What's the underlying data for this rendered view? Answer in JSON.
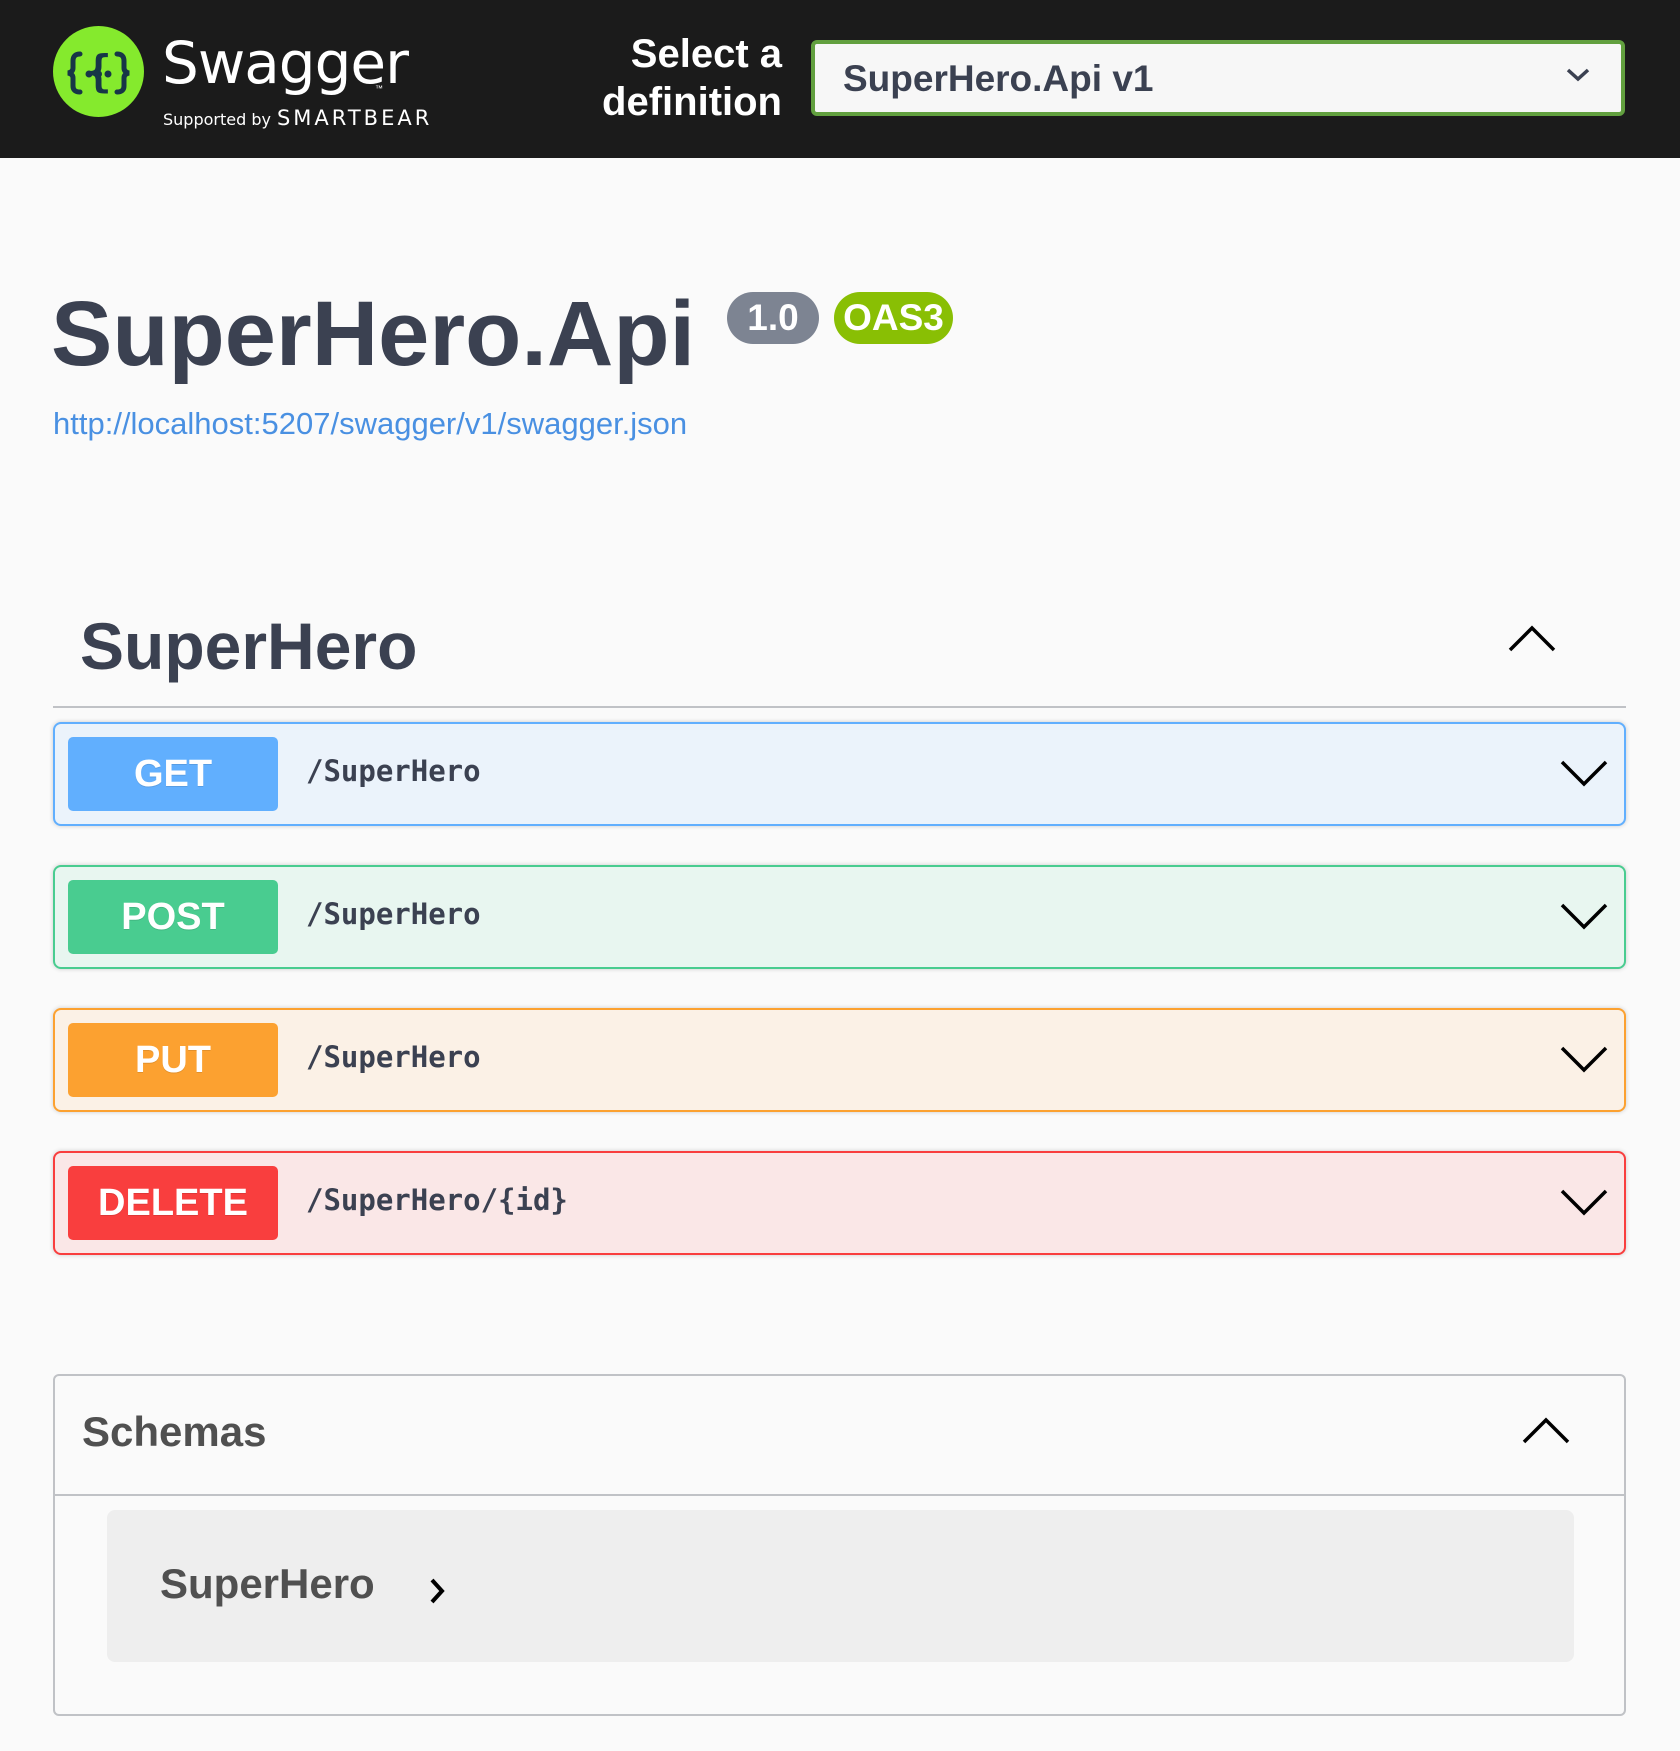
{
  "topbar": {
    "logo_text": "Swagger",
    "logo_tm": "™",
    "logo_sub_small": "Supported by",
    "logo_sub_brand": "SMARTBEAR",
    "select_label": "Select a definition",
    "selected_definition": "SuperHero.Api v1",
    "accent_color": "#85ea2d"
  },
  "info": {
    "title": "SuperHero.Api",
    "version": "1.0",
    "oas_badge": "OAS3",
    "spec_url": "http://localhost:5207/swagger/v1/swagger.json"
  },
  "tag": {
    "name": "SuperHero",
    "expanded": true,
    "operations": [
      {
        "method": "GET",
        "path": "/SuperHero",
        "color": "#61affe"
      },
      {
        "method": "POST",
        "path": "/SuperHero",
        "color": "#49cc90"
      },
      {
        "method": "PUT",
        "path": "/SuperHero",
        "color": "#fca130"
      },
      {
        "method": "DELETE",
        "path": "/SuperHero/{id}",
        "color": "#f93e3e"
      }
    ]
  },
  "schemas": {
    "title": "Schemas",
    "expanded": true,
    "models": [
      {
        "name": "SuperHero",
        "expanded": false
      }
    ]
  },
  "icons": {
    "logo": "swagger-braces-icon",
    "select_chevron": "chevron-down-icon",
    "tag_toggle": "chevron-up-icon",
    "op_toggle": "chevron-down-icon",
    "schemas_toggle": "chevron-up-icon",
    "model_toggle": "chevron-right-icon"
  }
}
